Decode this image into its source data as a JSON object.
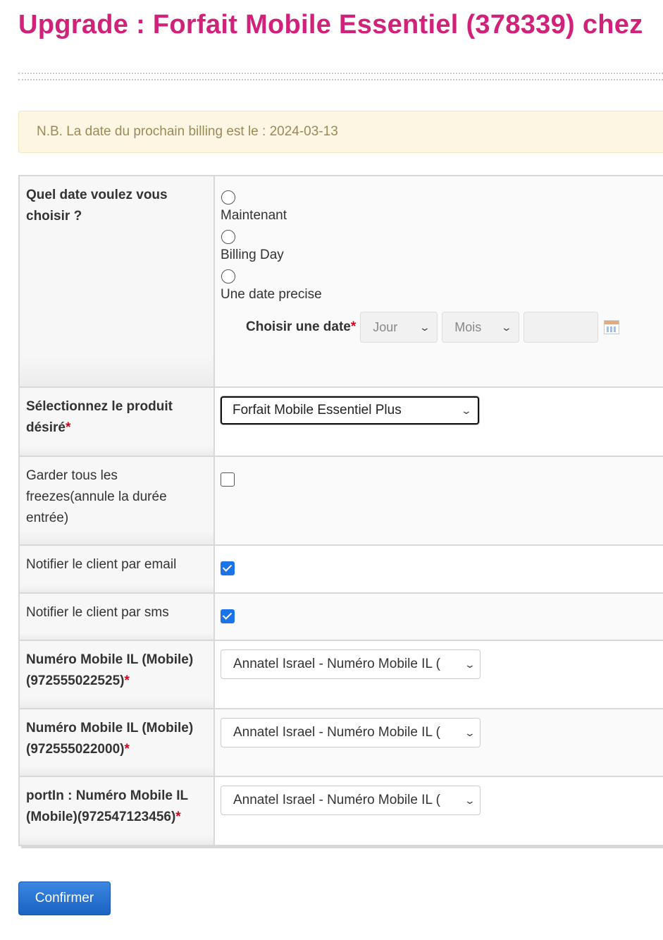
{
  "page": {
    "title": "Upgrade : Forfait Mobile Essentiel (378339) chez"
  },
  "note": {
    "text": "N.B. La date du prochain billing est le : 2024-03-13"
  },
  "date_choice": {
    "label": "Quel date voulez vous choisir ?",
    "options": [
      "Maintenant",
      "Billing Day",
      "Une date precise"
    ],
    "choose_date_label": "Choisir une date",
    "day_placeholder": "Jour",
    "month_placeholder": "Mois"
  },
  "product": {
    "label": "Sélectionnez le produit désiré",
    "selected": "Forfait Mobile Essentiel Plus"
  },
  "freezes": {
    "label": "Garder tous les freezes(annule la durée entrée)",
    "checked": false
  },
  "notify_email": {
    "label": "Notifier le client par email",
    "checked": true
  },
  "notify_sms": {
    "label": "Notifier le client par sms",
    "checked": true
  },
  "numbers": [
    {
      "label": "Numéro Mobile IL (Mobile)(972555022525)",
      "selected": "Annatel Israel - Numéro Mobile IL ("
    },
    {
      "label": "Numéro Mobile IL (Mobile)(972555022000)",
      "selected": "Annatel Israel - Numéro Mobile IL ("
    },
    {
      "label": "portIn : Numéro Mobile IL (Mobile)(972547123456)",
      "selected": "Annatel Israel - Numéro Mobile IL ("
    }
  ],
  "required_mark": "*",
  "actions": {
    "confirm_label": "Confirmer"
  },
  "colors": {
    "title": "#d0227a",
    "note_bg": "#fdf6e3",
    "note_text": "#9a8a5a",
    "button": "#1c62c4",
    "checkbox": "#1a73e8",
    "required": "#d0021b"
  },
  "icons": {
    "calendar": "calendar-icon",
    "chevron": "chevron-down-icon"
  }
}
